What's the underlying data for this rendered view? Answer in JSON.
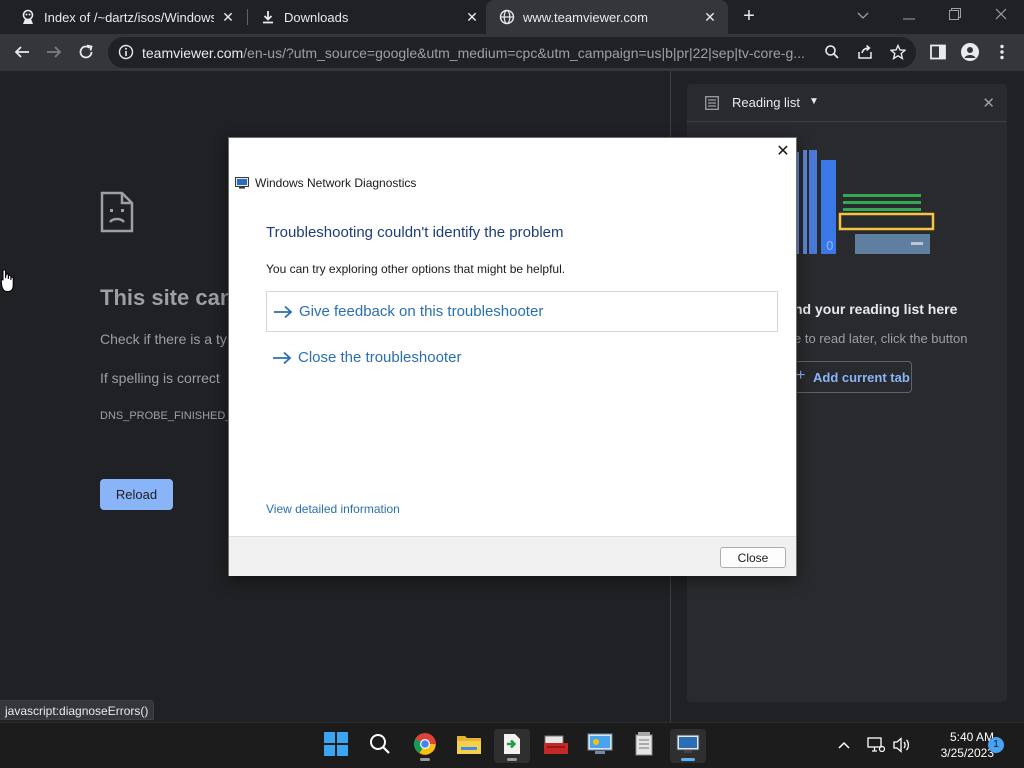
{
  "tabs": [
    {
      "title": "Index of /~dartz/isos/Windows/",
      "icon": "site-favicon"
    },
    {
      "title": "Downloads",
      "icon": "download-icon"
    },
    {
      "title": "www.teamviewer.com",
      "icon": "globe-icon",
      "active": true
    }
  ],
  "address": {
    "host": "teamviewer.com",
    "path": "/en-us/?utm_source=google&utm_medium=cpc&utm_campaign=us|b|pr|22|sep|tv-core-g..."
  },
  "error_page": {
    "heading": "This site can",
    "line1": "Check if there is a ty",
    "line2": "If spelling is correct",
    "code": "DNS_PROBE_FINISHED_",
    "reload_label": "Reload"
  },
  "reading_list": {
    "title": "Reading list",
    "empty_title": "nd your reading list here",
    "empty_desc": "e to read later, click the button",
    "add_label": "Add current tab"
  },
  "status_bar": "javascript:diagnoseErrors()",
  "dialog": {
    "app_title": "Windows Network Diagnostics",
    "heading": "Troubleshooting couldn't identify the problem",
    "subtext": "You can try exploring other options that might be helpful.",
    "options": [
      "Give feedback on this troubleshooter",
      "Close the troubleshooter"
    ],
    "details_link": "View detailed information",
    "close_label": "Close"
  },
  "taskbar": {
    "apps": [
      "start-button",
      "search-button",
      "chrome-app",
      "file-explorer-app",
      "downloads-app",
      "toolbox-app",
      "control-panel-app",
      "notepad-app",
      "network-diagnostics-app"
    ],
    "time": "5:40 AM",
    "date": "3/25/2023",
    "notification_count": "1"
  },
  "colors": {
    "accent": "#8ab4f8",
    "dialog_link": "#2a6fb0",
    "dialog_heading": "#1f3d7a"
  }
}
